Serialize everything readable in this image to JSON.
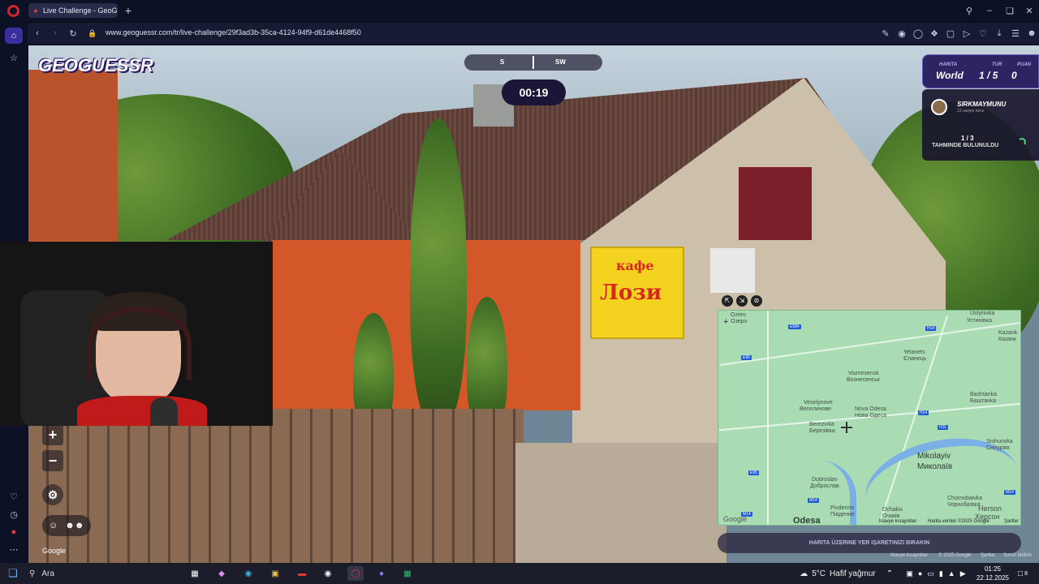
{
  "browser": {
    "tab_title": "Live Challenge - GeoGuessr",
    "url": "www.geoguessr.com/tr/live-challenge/29f3ad3b-35ca-4124-94f9-d61de4468f50"
  },
  "game": {
    "logo": "GEOGUESSR",
    "compass": {
      "south": "S",
      "southwest": "SW"
    },
    "timer": "00:19",
    "stats": {
      "map_label": "HARITA",
      "map_value": "World",
      "round_label": "TUR",
      "round_value": "1 / 5",
      "score_label": "PUAN",
      "score_value": "0"
    },
    "feed": {
      "player": "SIRKMAYMUNU",
      "player_sub": "12 saniye önce",
      "found_count": "1 / 3",
      "found_label": "TAHMINDE BULUNULDU"
    },
    "sign": {
      "line1": "кафе",
      "line2": "Лози"
    },
    "zoom_in": "+",
    "zoom_out": "−",
    "google": "Google",
    "place_button": "HARITA ÜZERINE YER IŞARETINIZI BIRAKIN",
    "footer_links": [
      "Klavye kısayolları",
      "© 2025 Google",
      "Şartlar",
      "Sorun bildirin"
    ]
  },
  "map": {
    "labels": [
      "Ozero",
      "Озеро",
      "Ustynivka",
      "Устинівка",
      "Kazank",
      "Казанк",
      "Yelanets",
      "Єланець",
      "Voznesensk",
      "Вознесенськ",
      "Veselynove",
      "Веселинове",
      "Nova Odesa",
      "Нова Одеса",
      "Bashtanka",
      "Баштанка",
      "Berezivka",
      "Березівка",
      "Snihurivka",
      "Снігурівк",
      "Dobroslav",
      "Доброслав",
      "Chornobaivka",
      "Чорнобаївка",
      "Pivdenne",
      "Південне",
      "Ochakiv",
      "Очаків",
      "Herson",
      "Херсон",
      "Odesa"
    ],
    "big_city": {
      "latin": "Mikolayiv",
      "cyrillic": "Миколаїв"
    },
    "highways": [
      "E584",
      "H14",
      "E95",
      "H14",
      "H11",
      "E95",
      "M14",
      "M14",
      "M14"
    ],
    "attribution": [
      "Klavye kısayolları",
      "Harita verileri ©2025 Google",
      "Şartlar"
    ]
  },
  "taskbar": {
    "search": "Ara",
    "weather_temp": "5°C",
    "weather_desc": "Hafif yağmur",
    "time": "01:25",
    "date": "22.12.2025",
    "notification_count": "8"
  }
}
